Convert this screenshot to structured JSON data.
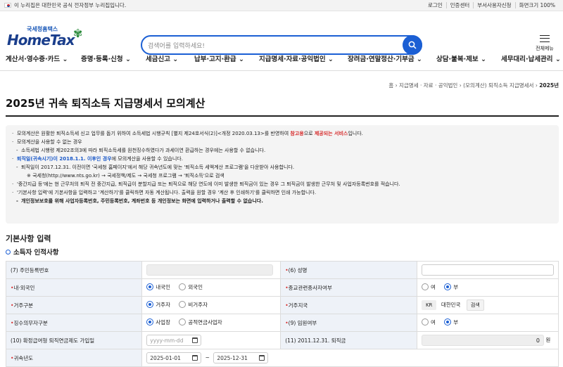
{
  "gov_banner": {
    "text": "이 누리집은 대한민국 공식 전자정부 누리집입니다.",
    "links": [
      "로그인",
      "인증센터",
      "부서사용자신청",
      "화면크기 100%"
    ]
  },
  "logo": {
    "sub": "국세청홈택스",
    "main": "HomeTax"
  },
  "search": {
    "placeholder": "검색어를 입력하세요!"
  },
  "menu_all": "전체메뉴",
  "nav": [
    "계산서·영수증·카드",
    "증명·등록·신청",
    "세금신고",
    "납부·고지·환급",
    "지급명세·자료·공익법인",
    "장려금·연말정산·기부금",
    "상담·불복·제보",
    "세무대리·납세관리"
  ],
  "breadcrumb": [
    "홈",
    "지급명세 · 자료 · 공익법인",
    "(모의계산) 퇴직소득 지급명세서",
    "2025년"
  ],
  "page_title": "2025년 귀속 퇴직소득 지급명세서 모의계산",
  "info": {
    "l1a": "모의계산은 원활한 퇴직소득세 신고 업무를 돕기 위하여 소득세법 시행규칙 [별지 제24호서식(2)]<개정 2020.03.13>를 반영하여 ",
    "l1b": "참고용",
    "l1c": "으로 ",
    "l1d": "제공되는 서비스",
    "l1e": "입니다.",
    "l2": "모의계산을 사용할 수 없는 경우",
    "l3": "소득세법 시행령 제202조의3에 따라 퇴직소득세를 원천징수하였다가 과세이연 환급하는 경우에는 사용할 수 없습니다.",
    "l4a": "퇴직일(귀속시기)이 2018.1.1. 이후인 경우",
    "l4b": "에 모의계산을 사용할 수 있습니다.",
    "l5": "퇴직일이 2017.12.31. 이전이면 '국세청 홈페이지'에서 해당 귀속년도에 맞는 '퇴직소득 세액계산 프로그램'을 다운받아 사용합니다.",
    "l6": "※ 국세청(http://www.nts.go.kr) → 국세정책/제도 → 국세청 프로그램 → '퇴직소득'으로 검색",
    "l7": "'중간지급 등'에는 현 근무처의 퇴직 전 중간지급, 퇴직급이 분할지급 또는 퇴직으로 해당 연도에 이미 발생한 퇴직금이 있는 경우 그 퇴직금이 발생한 근무처 및 사업자등록번호를 적습니다.",
    "l8": "'기본사항 입력'에 기본사항을 입력하고 '계산하기'를 클릭하면 자동 계산됩니다. 출력을 원할 경우 '계산 후 인쇄하기'를 클릭하면 인쇄 가능합니다.",
    "l9": "개인정보보호를 위해 사업자등록번호, 주민등록번호, 계좌번호 등 개인정보는 화면에 입력하거나 출력할 수 없습니다."
  },
  "section_title": "기본사항 입력",
  "subsection_title": "소득자 인적사항",
  "form": {
    "ssn_label": "(7) 주민등록번호",
    "name_label": "(6) 성명",
    "nationality_label": "내·외국인",
    "nationality_opts": [
      "내국인",
      "외국인"
    ],
    "religion_label": "종교관련종사자여부",
    "yn": [
      "여",
      "부"
    ],
    "residency_label": "거주구분",
    "residency_opts": [
      "거주자",
      "비거주자"
    ],
    "country_label": "거주지국",
    "country_code": "KR",
    "country_name": "대한민국",
    "country_btn": "검색",
    "duty_label": "징수의무자구분",
    "duty_opts": [
      "사업장",
      "공적연금사업자"
    ],
    "exec_label": "(9) 임원여부",
    "pension_label": "(10) 확정급여형 퇴직연금제도 가입일",
    "date_placeholder": "yyyy-mm-dd",
    "severance_label": "(11) 2011.12.31. 퇴직금",
    "severance_value": "0",
    "severance_unit": "원",
    "year_label": "귀속년도",
    "year_from": "2025-01-01",
    "year_sep": "~",
    "year_to": "2025-12-31"
  },
  "colors": {
    "accent": "#1b5fd4",
    "required": "#d62b2b"
  }
}
